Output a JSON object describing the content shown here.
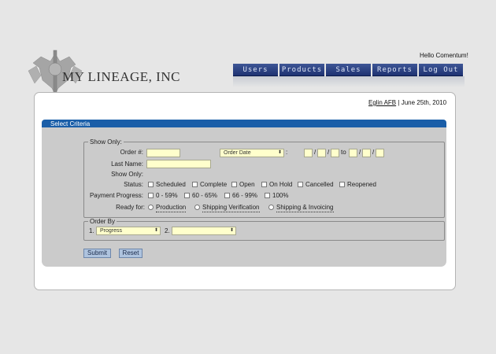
{
  "brand": {
    "name": "MY LINEAGE, INC"
  },
  "header": {
    "greeting": "Hello Comentum!"
  },
  "nav": {
    "items": [
      {
        "label": "Users"
      },
      {
        "label": "Products"
      },
      {
        "label": "Sales"
      },
      {
        "label": "Reports"
      },
      {
        "label": "Log Out"
      }
    ]
  },
  "location": {
    "link": "Eglin AFB",
    "separator": "|",
    "date": "June 25th, 2010"
  },
  "criteria": {
    "title": "Select Criteria",
    "show_only": {
      "legend": "Show Only:",
      "order_num_label": "Order #:",
      "order_num_value": "",
      "date_type": "Order Date",
      "date_colon": ":",
      "date_sep": "/",
      "date_to": "to",
      "last_name_label": "Last Name:",
      "last_name_value": "",
      "show_only_label": "Show Only:",
      "status_label": "Status:",
      "status_options": [
        "Scheduled",
        "Complete",
        "Open",
        "On Hold",
        "Cancelled",
        "Reopened"
      ],
      "payment_label": "Payment Progress:",
      "payment_options": [
        "0 - 59%",
        "60 - 65%",
        "66 - 99%",
        "100%"
      ],
      "ready_label": "Ready for:",
      "ready_options": [
        "Production",
        "Shipping Verification",
        "Shipping & Invoicing"
      ]
    },
    "order_by": {
      "legend": "Order By",
      "num1": "1.",
      "sort1": "Progress",
      "num2": "2.",
      "sort2": ""
    },
    "buttons": {
      "submit": "Submit",
      "reset": "Reset"
    }
  }
}
